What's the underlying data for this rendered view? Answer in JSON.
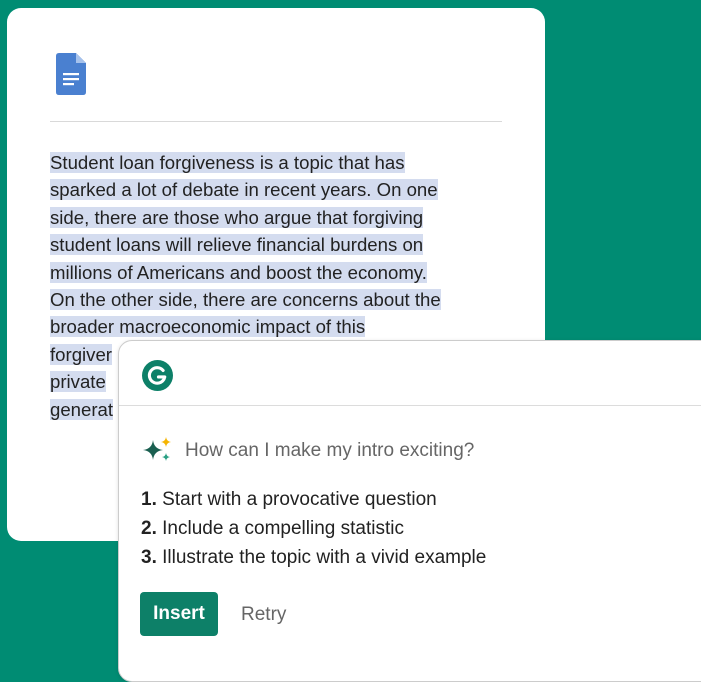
{
  "colors": {
    "background": "#008c73",
    "selection_highlight": "#d4dcef",
    "accent": "#0d8068",
    "doc_icon": "#4a80d0",
    "sparkle_large": "#1a5f50",
    "sparkle_small": "#f5b400"
  },
  "document": {
    "icon": "google-docs-icon",
    "lines": [
      "Student loan forgiveness is a topic that has",
      "sparked a lot of debate in recent years. On one",
      "side, there are those who argue that forgiving",
      "student loans will relieve financial burdens on",
      "millions of Americans and boost the economy.",
      "On the other side, there are concerns about the",
      "broader macroeconomic impact of this",
      "forgiver",
      "private",
      "generat"
    ]
  },
  "assistant": {
    "logo": "grammarly-logo-icon",
    "prompt_icon": "sparkle-icon",
    "prompt": "How can I make my intro exciting?",
    "suggestions": [
      {
        "num": "1.",
        "text": "Start with a provocative question"
      },
      {
        "num": "2.",
        "text": "Include a compelling statistic"
      },
      {
        "num": "3.",
        "text": "Illustrate the topic with a vivid example"
      }
    ],
    "insert_label": "Insert",
    "retry_label": "Retry"
  }
}
